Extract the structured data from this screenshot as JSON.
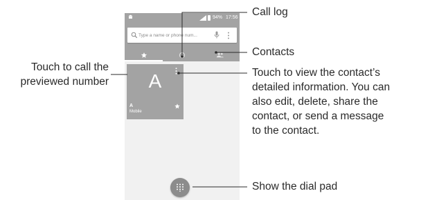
{
  "status_bar": {
    "battery_percent": "94%",
    "time": "17:56"
  },
  "search": {
    "placeholder": "Type a name or phone num..."
  },
  "tabs": [
    {
      "icon": "star-icon",
      "active": true
    },
    {
      "icon": "clock-icon",
      "active": false
    },
    {
      "icon": "people-icon",
      "active": false
    }
  ],
  "contact_card": {
    "initial": "A",
    "name": "A",
    "type": "Mobile"
  },
  "callouts": {
    "call_log": "Call log",
    "contacts": "Contacts",
    "touch_call_line1": "Touch to call the",
    "touch_call_line2": "previewed number",
    "view_line1": "Touch to view the contact’s",
    "view_line2": "detailed information. You can",
    "view_line3": "also edit, delete, share the",
    "view_line4": "contact, or send a message",
    "view_line5": "to the contact.",
    "dial_pad": "Show the dial pad"
  },
  "colors": {
    "app_gray": "#a3a3a3",
    "fab_gray": "#8c8c8c",
    "screen_bg": "#f1f1f1",
    "text": "#2a2a2a"
  }
}
